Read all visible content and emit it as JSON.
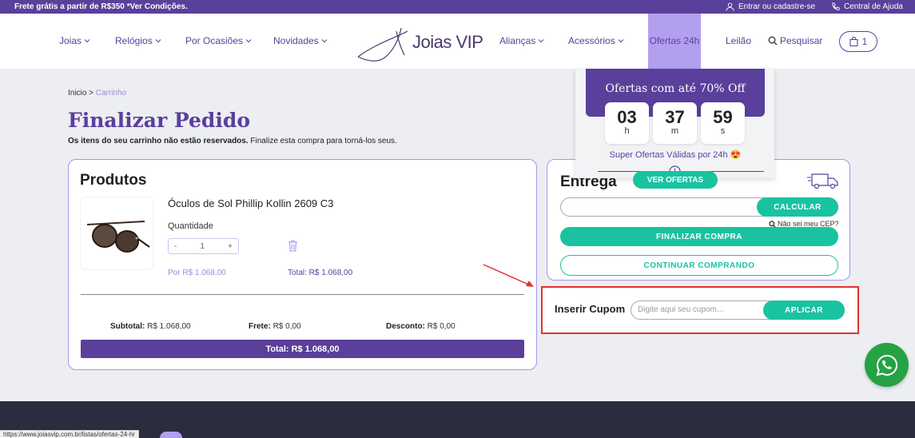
{
  "topbar": {
    "promo": "Frete grátis a partir de R$350 *Ver Condições.",
    "login": "Entrar ou cadastre-se",
    "help": "Central de Ajuda"
  },
  "nav": {
    "joias": "Joias",
    "relogios": "Relógios",
    "ocasioes": "Por Ocasiões",
    "novidades": "Novidades",
    "logo": "Joias VIP",
    "aliancas": "Alianças",
    "acessorios": "Acessórios",
    "ofertas": "Ofertas 24h",
    "leilao": "Leilão",
    "pesquisar": "Pesquisar",
    "cart_count": "1"
  },
  "breadcrumb": {
    "home": "Inicio >",
    "current": "Carrinho"
  },
  "page": {
    "title": "Finalizar Pedido",
    "subtitle_bold": "Os itens do seu carrinho não estão reservados.",
    "subtitle_rest": " Finalize esta compra para torná-los seus."
  },
  "products": {
    "title": "Produtos",
    "item": {
      "name": "Óculos de Sol Phillip Kollin 2609 C3",
      "qty_label": "Quantidade",
      "qty_minus": "-",
      "qty_value": "1",
      "qty_plus": "+",
      "unit_price": "Por R$ 1.068,00",
      "total": "Total: R$ 1.068,00"
    },
    "summary": {
      "subtotal_label": "Subtotal:",
      "subtotal_value": " R$ 1.068,00",
      "frete_label": "Frete:",
      "frete_value": " R$ 0,00",
      "desconto_label": "Desconto:",
      "desconto_value": " R$ 0,00",
      "grand_total": "Total: R$ 1.068,00"
    }
  },
  "delivery": {
    "title": "Entrega",
    "calcular": "CALCULAR",
    "nao_sei": "Não sei meu CEP?",
    "finalizar": "FINALIZAR COMPRA",
    "continuar": "CONTINUAR COMPRANDO"
  },
  "coupon": {
    "label": "Inserir Cupom",
    "placeholder": "Digite aqui seu cupom...",
    "aplicar": "APLICAR"
  },
  "offer": {
    "title": "Ofertas com até 70% Off",
    "hours": "03",
    "hours_unit": "h",
    "minutes": "37",
    "minutes_unit": "m",
    "seconds": "59",
    "seconds_unit": "s",
    "subtitle": "Super Ofertas Válidas por 24h 😍",
    "button": "VER OFERTAS"
  },
  "status_url": "https://www.joiasvip.com.br/listas/ofertas-24-hr",
  "colors": {
    "brand_purple": "#5a3f9b",
    "accent_green": "#19c3a0",
    "highlight_red": "#e53030"
  }
}
